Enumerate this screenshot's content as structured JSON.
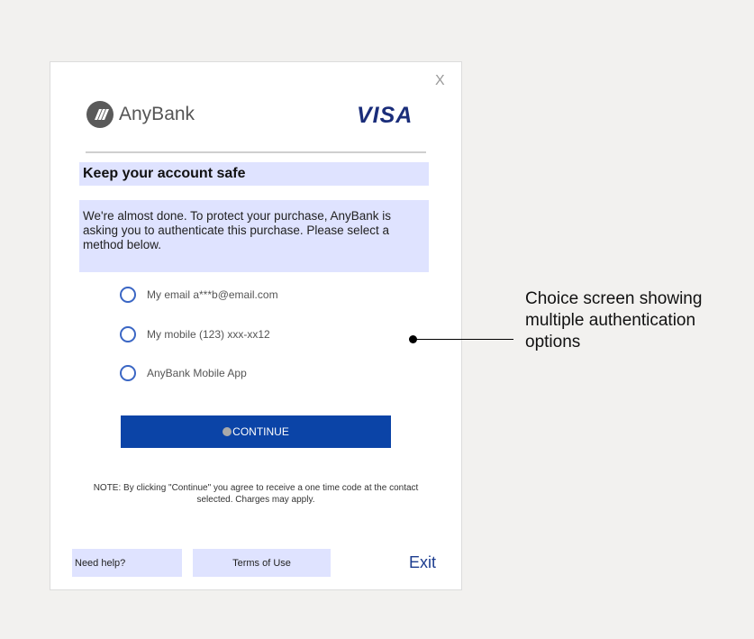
{
  "dialog": {
    "close_label": "X",
    "bank_name": "AnyBank",
    "card_network": "VISA",
    "heading": "Keep your account safe",
    "message": "We're almost done. To protect your purchase, AnyBank is asking you to authenticate this purchase. Please select a method below.",
    "options": [
      {
        "label": "My email a***b@email.com"
      },
      {
        "label": "My mobile (123) xxx-xx12"
      },
      {
        "label": "AnyBank Mobile App"
      }
    ],
    "continue_label": "CONTINUE",
    "note": "NOTE: By clicking \"Continue\" you agree to receive a one time code at the contact selected. Charges may apply.",
    "footer": {
      "help_label": "Need help?",
      "terms_label": "Terms of Use",
      "exit_label": "Exit"
    }
  },
  "callout": {
    "text": "Choice screen showing multiple authentication options"
  },
  "colors": {
    "accent_blue": "#0b44a7",
    "highlight_bg": "#dfe3ff",
    "visa_blue": "#1a2d7a",
    "radio_blue": "#3a66c4"
  },
  "icons": {
    "bank_logo": "anybank-logo-icon",
    "close": "close-icon",
    "radio": "radio-icon"
  }
}
